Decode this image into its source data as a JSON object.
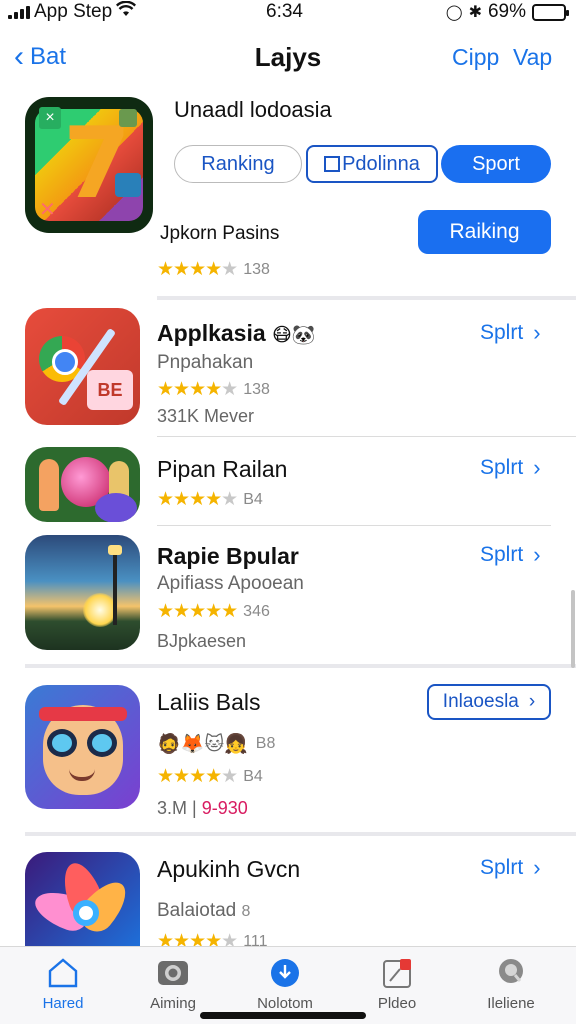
{
  "status_bar": {
    "carrier": "App Step",
    "time": "6:34",
    "battery": "69%",
    "battery_level": 0.69
  },
  "nav": {
    "back_label": "Bat",
    "title": "Lajys",
    "right_1": "Cipp",
    "right_2": "Vap"
  },
  "featured": {
    "name": "Unaadl lodoasia",
    "pill_ranking": "Ranking",
    "pill_bookmark": "Pdolinna",
    "pill_sport": "Sport",
    "subtitle": "Jpkorn Pasins",
    "primary_button": "Raiking",
    "rating": "138",
    "rating_value": 4.5
  },
  "apps": [
    {
      "name": "Applkasia",
      "subtitle": "Pnpahakan",
      "rating": "138",
      "rating_value": 4.5,
      "extra": "331K Mever",
      "action": "Splrt"
    },
    {
      "name": "Pipan Railan",
      "rating": "B4",
      "rating_value": 4.5,
      "action": "Splrt"
    },
    {
      "name": "Rapie Bpular",
      "subtitle": "Apifiass Apooean",
      "rating": "346",
      "rating_value": 5,
      "extra": "BJpkaesen",
      "action": "Splrt"
    },
    {
      "name": "Laliis Bals",
      "emoji_meta": "🧔🦊🐱👧",
      "emoji_count": "B8",
      "rating": "B4",
      "rating_value": 4.5,
      "extra_prefix": "3.M |",
      "extra_highlight": "9-930",
      "action": "Inlaoesla"
    },
    {
      "name": "Apukinh Gvcn",
      "subtitle": "Balaiotad",
      "subtitle_suffix": "8",
      "rating": "111",
      "rating_value": 4.5,
      "action": "Splrt"
    }
  ],
  "tabs": [
    {
      "label": "Hared",
      "icon": "home-icon",
      "active": true
    },
    {
      "label": "Aiming",
      "icon": "camera-icon",
      "active": false
    },
    {
      "label": "Nolotom",
      "icon": "download-icon",
      "active": false
    },
    {
      "label": "Pldeo",
      "icon": "video-icon",
      "active": false
    },
    {
      "label": "Ileliene",
      "icon": "search-icon",
      "active": false
    }
  ],
  "colors": {
    "accent": "#1a73e8",
    "primary_button": "#1a6ff0",
    "star": "#f5b400",
    "battery": "#34c759"
  }
}
